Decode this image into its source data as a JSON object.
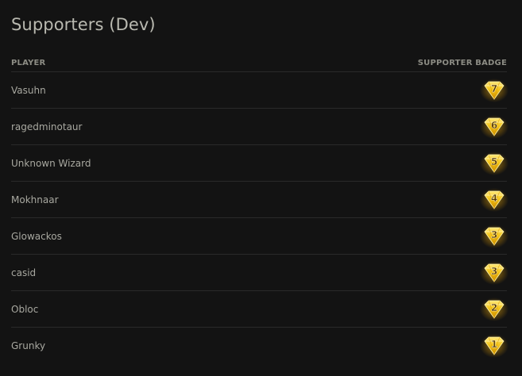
{
  "page": {
    "title": "Supporters (Dev)"
  },
  "table": {
    "columns": {
      "player": "PLAYER",
      "badge": "SUPPORTER BADGE"
    },
    "rows": [
      {
        "player": "Vasuhn",
        "badge": "7"
      },
      {
        "player": "ragedminotaur",
        "badge": "6"
      },
      {
        "player": "Unknown Wizard",
        "badge": "5"
      },
      {
        "player": "Mokhnaar",
        "badge": "4"
      },
      {
        "player": "Glowackos",
        "badge": "3"
      },
      {
        "player": "casid",
        "badge": "3"
      },
      {
        "player": "Obloc",
        "badge": "2"
      },
      {
        "player": "Grunky",
        "badge": "1"
      }
    ]
  },
  "colors": {
    "background": "#131313",
    "title": "#b9b9b0",
    "header_text": "#8c8c84",
    "row_text": "#a8a8a0",
    "divider": "#2a2a2a",
    "gem_gold": "#f2c21a",
    "gem_glow": "#ffe45c"
  },
  "icons": {
    "badge": "gold-diamond-gem-icon"
  }
}
